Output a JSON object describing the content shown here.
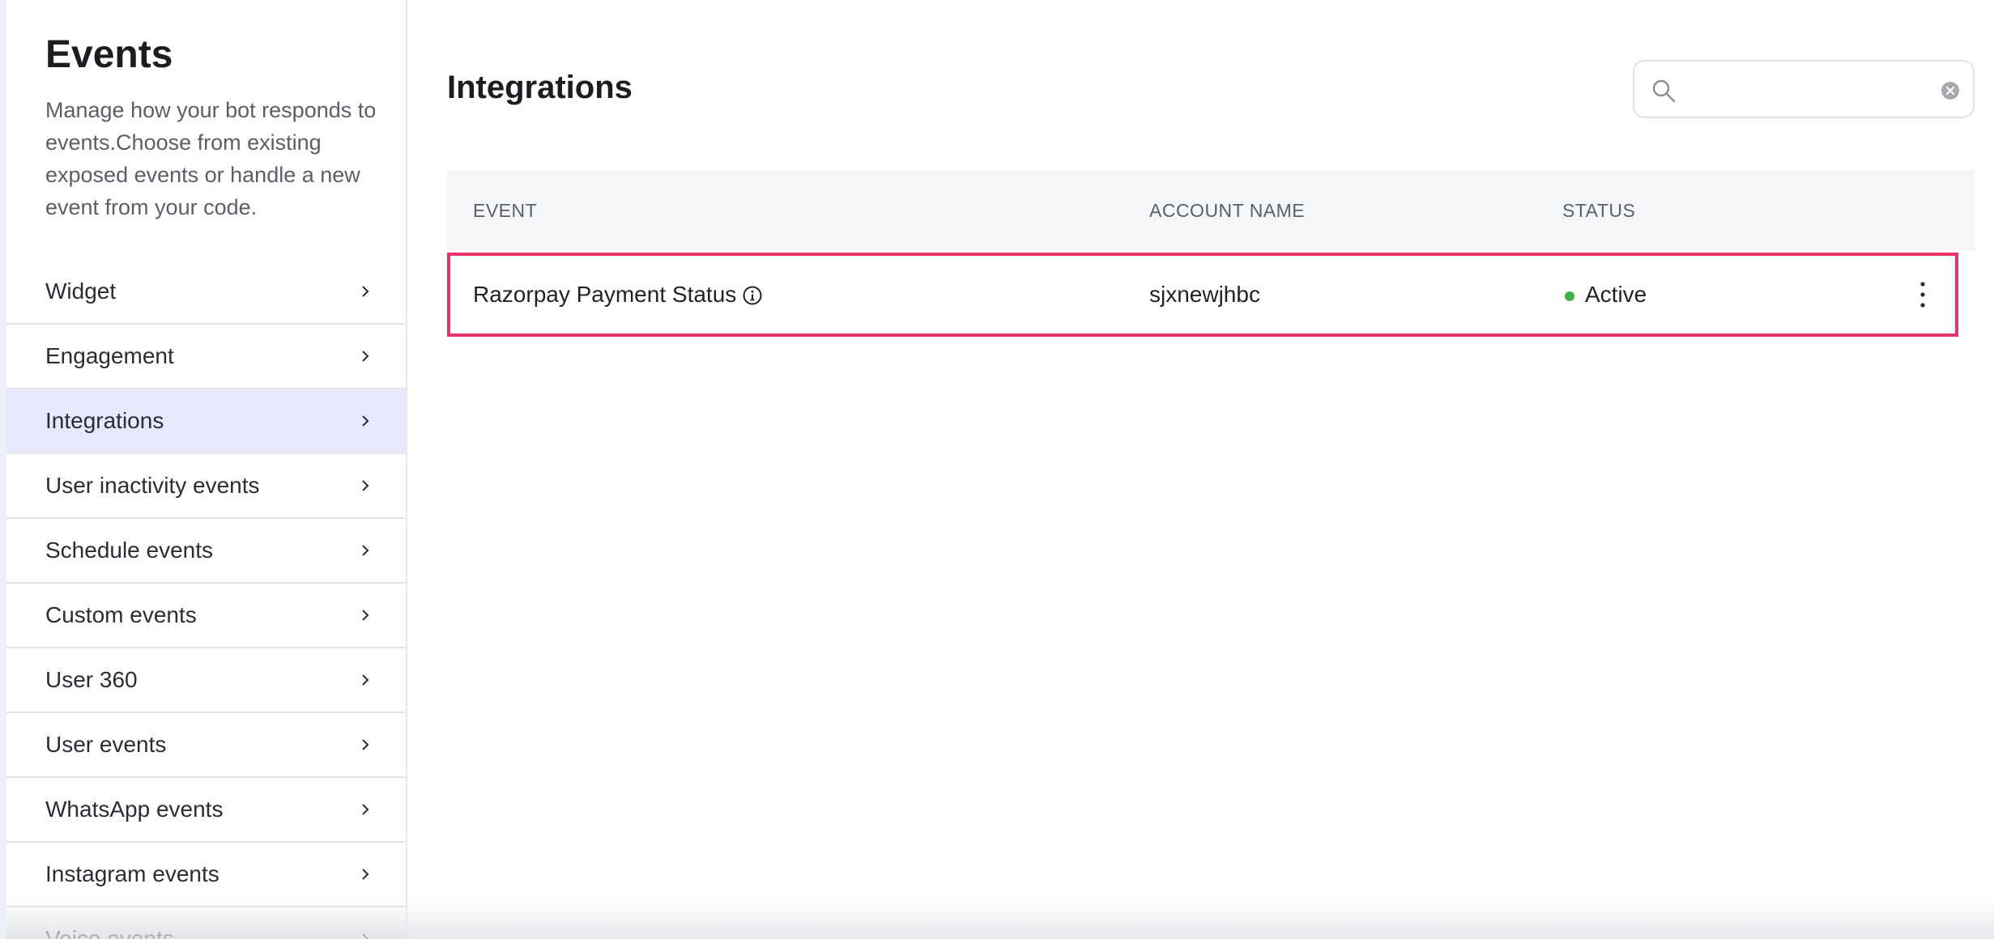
{
  "sidebar": {
    "title": "Events",
    "description": "Manage how your bot responds to events.Choose from existing exposed events or handle a new event from your code.",
    "items": [
      {
        "label": "Widget"
      },
      {
        "label": "Engagement"
      },
      {
        "label": "Integrations",
        "active": true
      },
      {
        "label": "User inactivity events"
      },
      {
        "label": "Schedule events"
      },
      {
        "label": "Custom events"
      },
      {
        "label": "User 360"
      },
      {
        "label": "User events"
      },
      {
        "label": "WhatsApp events"
      },
      {
        "label": "Instagram events"
      },
      {
        "label": "Voice events"
      }
    ]
  },
  "main": {
    "title": "Integrations",
    "search": {
      "value": "",
      "placeholder": ""
    },
    "table": {
      "headers": {
        "event": "EVENT",
        "account_name": "ACCOUNT NAME",
        "status": "STATUS"
      },
      "rows": [
        {
          "event": "Razorpay Payment Status",
          "account_name": "sjxnewjhbc",
          "status": "Active"
        }
      ]
    }
  },
  "colors": {
    "accent_highlight": "#e8336b",
    "active_nav_bg": "#e6e8fb",
    "status_active": "#3bb54a"
  },
  "icons": {
    "nav_chevron": "chevron-right-icon",
    "search": "search-icon",
    "clear": "clear-icon",
    "info": "info-icon",
    "more": "kebab-menu-icon"
  }
}
